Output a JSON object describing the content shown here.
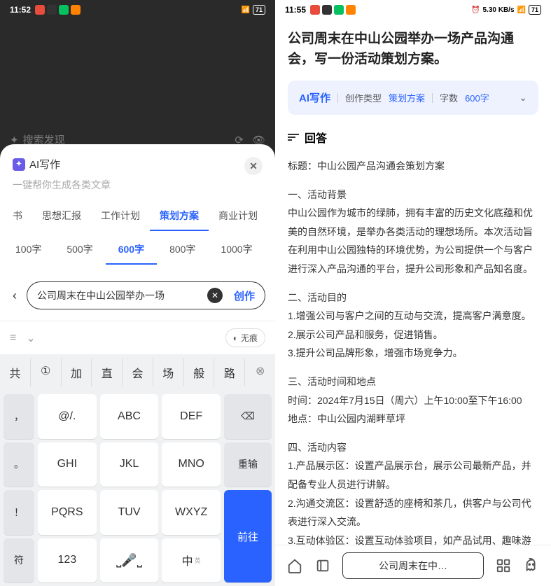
{
  "left": {
    "status": {
      "time": "11:52",
      "battery": "71"
    },
    "search_discover": "搜索发现",
    "sheet": {
      "title": "AI写作",
      "subtitle": "一键帮你生成各类文章",
      "close": "✕"
    },
    "type_tabs": [
      "书",
      "思想汇报",
      "工作计划",
      "策划方案",
      "商业计划"
    ],
    "type_active_index": 3,
    "word_tabs": [
      "100字",
      "500字",
      "600字",
      "800字",
      "1000字"
    ],
    "word_active_index": 2,
    "input_value": "公司周末在中山公园举办一场",
    "create_label": "创作",
    "stealth_label": "无痕",
    "suggestions": [
      "共",
      "①",
      "加",
      "直",
      "会",
      "场",
      "般",
      "路"
    ],
    "keys": {
      "row1": [
        "，",
        "@/.",
        "ABC",
        "DEF"
      ],
      "row2": [
        "。",
        "GHI",
        "JKL",
        "MNO",
        "重输"
      ],
      "row3": [
        "！",
        "PQRS",
        "TUV",
        "WXYZ"
      ],
      "row4": [
        "符",
        "123",
        "中"
      ],
      "go": "前往",
      "backspace": "⌫",
      "sub_en": "英"
    }
  },
  "right": {
    "status": {
      "time": "11:55",
      "battery": "71",
      "net": "5.30 KB/s"
    },
    "prompt": "公司周末在中山公园举办一场产品沟通会，写一份活动策划方案。",
    "banner": {
      "brand": "AI写作",
      "type_label": "创作类型",
      "type_value": "策划方案",
      "word_label": "字数",
      "word_value": "600字"
    },
    "answer_label": "回答",
    "article": {
      "title_label": "标题：",
      "title_value": "中山公园产品沟通会策划方案",
      "s1_h": "一、活动背景",
      "s1_p": "中山公园作为城市的绿肺，拥有丰富的历史文化底蕴和优美的自然环境，是举办各类活动的理想场所。本次活动旨在利用中山公园独特的环境优势，为公司提供一个与客户进行深入产品沟通的平台，提升公司形象和产品知名度。",
      "s2_h": "二、活动目的",
      "s2_1": "1.增强公司与客户之间的互动与交流，提高客户满意度。",
      "s2_2": "2.展示公司产品和服务，促进销售。",
      "s2_3": "3.提升公司品牌形象，增强市场竞争力。",
      "s3_h": "三、活动时间和地点",
      "s3_1": "时间：2024年7月15日（周六）上午10:00至下午16:00",
      "s3_2": "地点：中山公园内湖畔草坪",
      "s4_h": "四、活动内容",
      "s4_1": "1.产品展示区：设置产品展示台，展示公司最新产品，并配备专业人员进行讲解。",
      "s4_2": "2.沟通交流区：设置舒适的座椅和茶几，供客户与公司代表进行深入交流。",
      "s4_3": "3.互动体验区：设置互动体验项目，如产品试用、趣味游"
    },
    "address_bar": "公司周末在中…"
  }
}
